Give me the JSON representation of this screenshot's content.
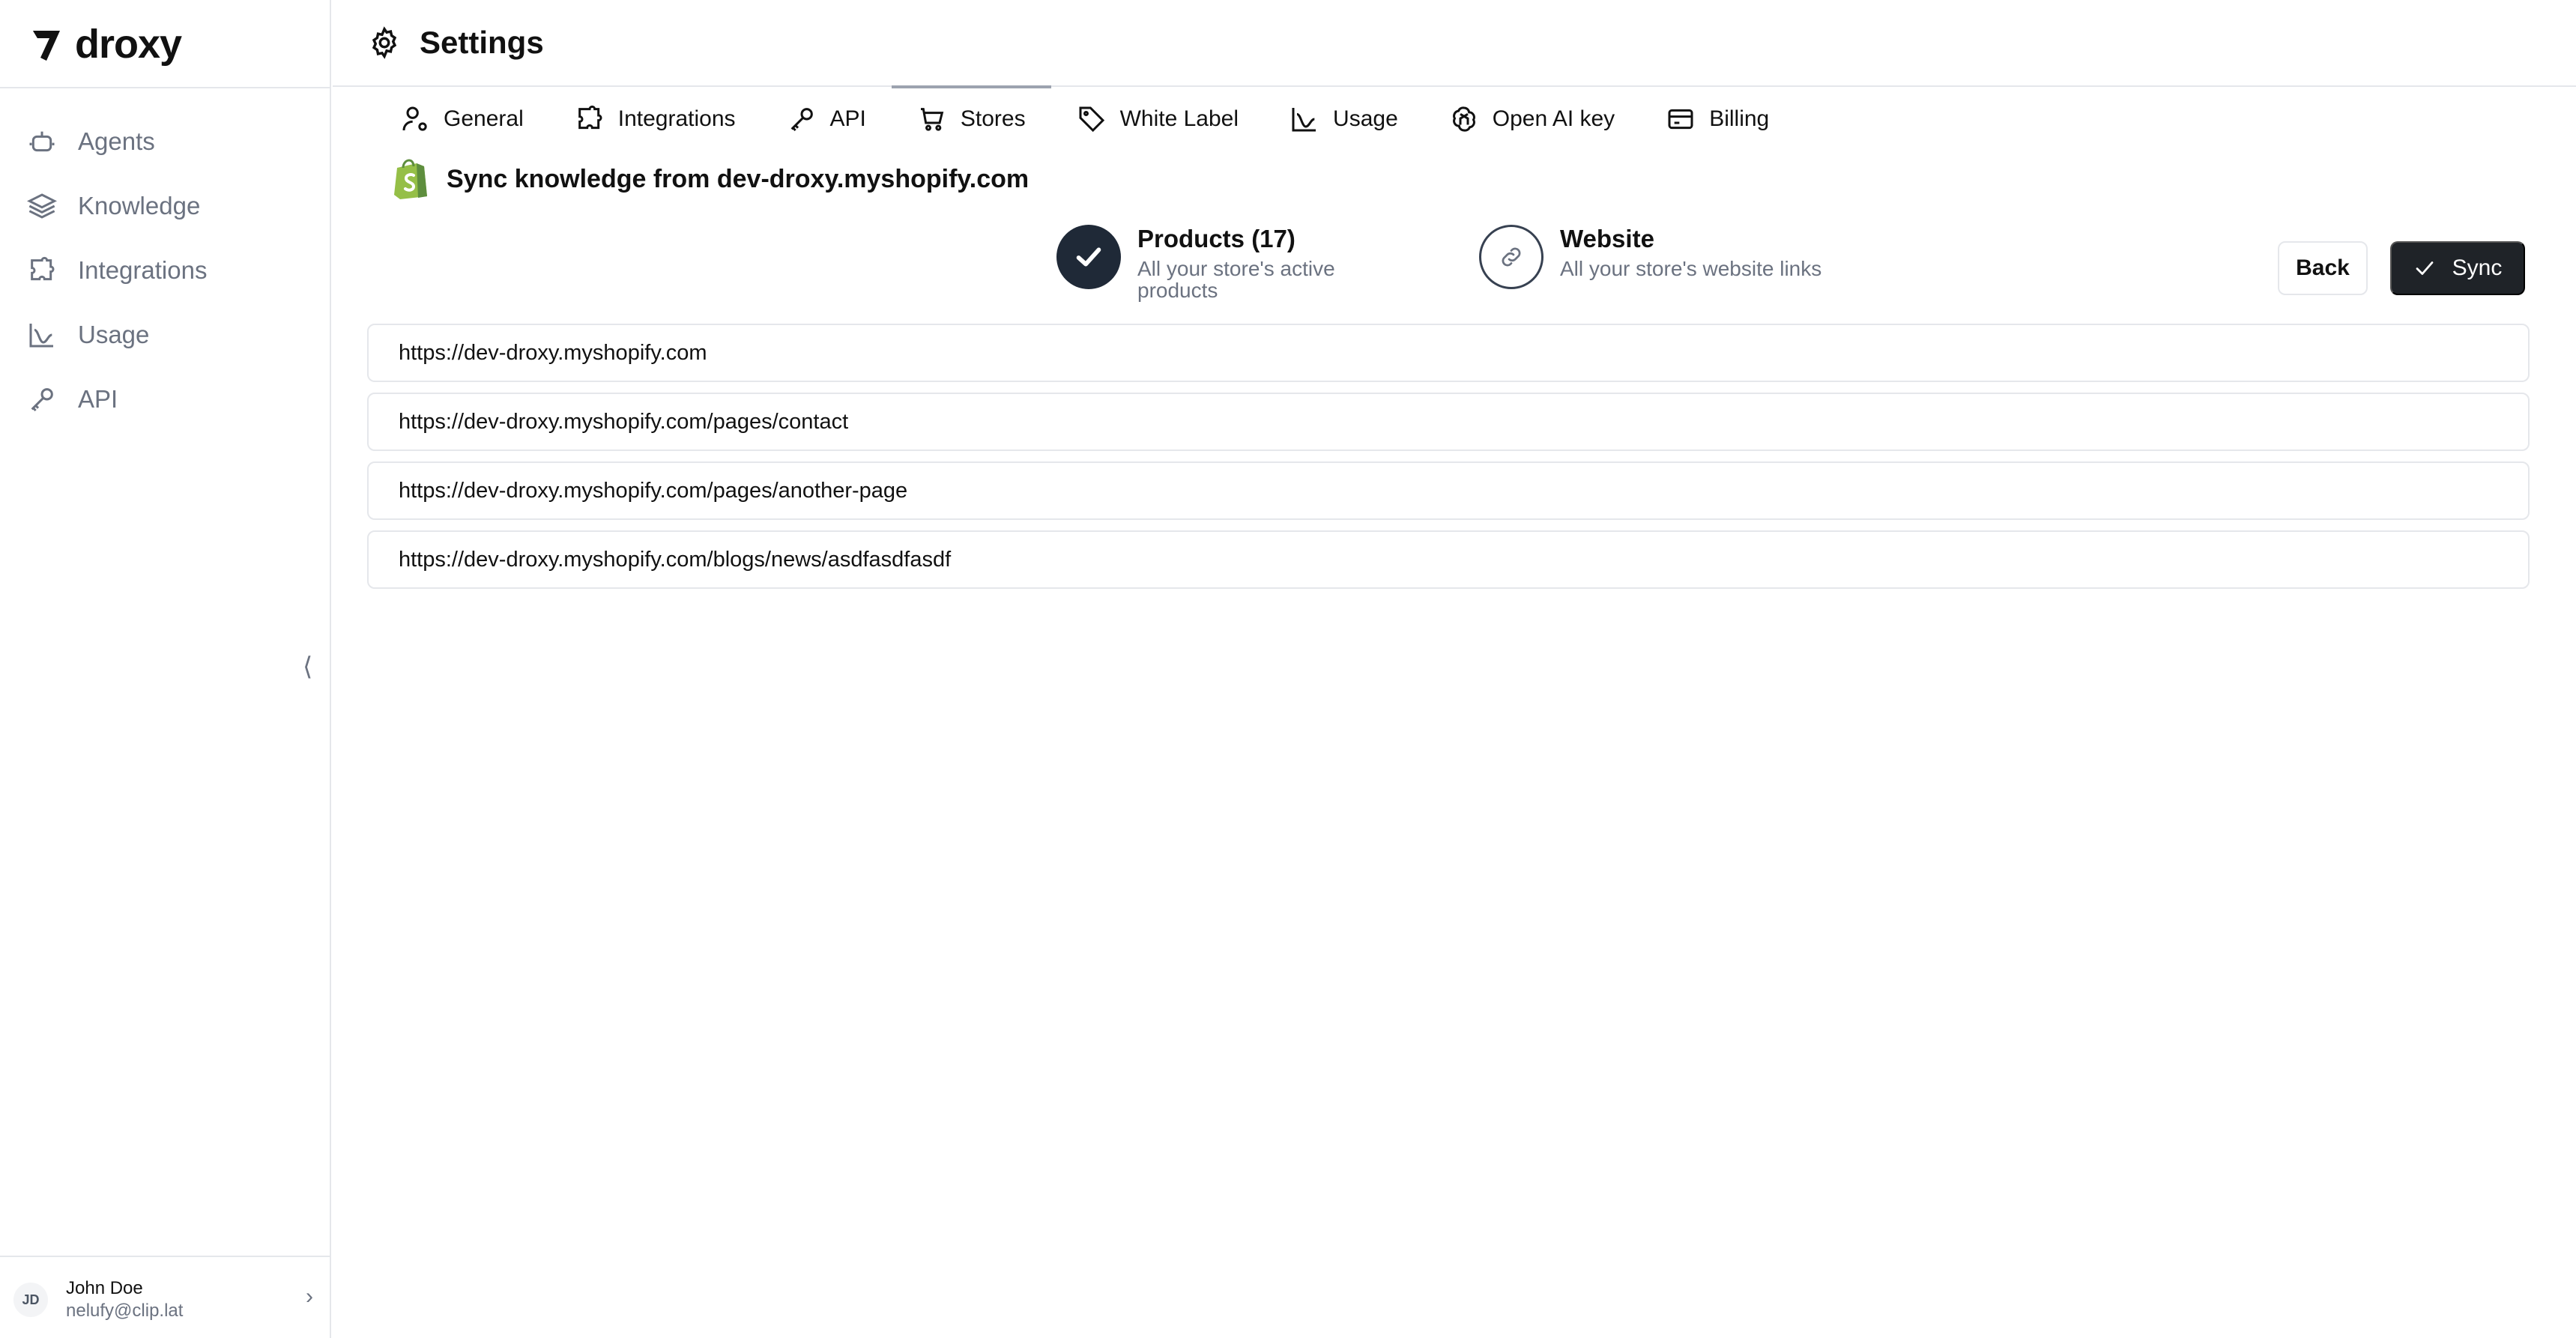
{
  "brand": {
    "name": "droxy"
  },
  "sidebar": {
    "items": [
      {
        "label": "Agents",
        "icon": "bot-icon"
      },
      {
        "label": "Knowledge",
        "icon": "layers-icon"
      },
      {
        "label": "Integrations",
        "icon": "puzzle-icon"
      },
      {
        "label": "Usage",
        "icon": "chart-icon"
      },
      {
        "label": "API",
        "icon": "key-icon"
      }
    ],
    "collapse_glyph": "⟨"
  },
  "user": {
    "initials": "JD",
    "name": "John Doe",
    "email": "nelufy@clip.lat"
  },
  "header": {
    "title": "Settings"
  },
  "tabs": [
    {
      "label": "General",
      "icon": "user-gear-icon"
    },
    {
      "label": "Integrations",
      "icon": "puzzle-icon"
    },
    {
      "label": "API",
      "icon": "key-icon"
    },
    {
      "label": "Stores",
      "icon": "cart-icon",
      "active": true
    },
    {
      "label": "White Label",
      "icon": "tag-icon"
    },
    {
      "label": "Usage",
      "icon": "chart-icon"
    },
    {
      "label": "Open AI key",
      "icon": "openai-icon"
    },
    {
      "label": "Billing",
      "icon": "card-icon"
    }
  ],
  "sync": {
    "title": "Sync knowledge from dev-droxy.myshopify.com"
  },
  "steps": [
    {
      "title": "Products (17)",
      "desc": "All your store's active products",
      "status": "done"
    },
    {
      "title": "Website",
      "desc": "All your store's website links",
      "status": "current"
    }
  ],
  "buttons": {
    "back": "Back",
    "sync": "Sync"
  },
  "urls": [
    "https://dev-droxy.myshopify.com",
    "https://dev-droxy.myshopify.com/pages/contact",
    "https://dev-droxy.myshopify.com/pages/another-page",
    "https://dev-droxy.myshopify.com/blogs/news/asdfasdfasdf"
  ],
  "colors": {
    "primary": "#1f2328",
    "muted": "#6b7280",
    "border": "#e5e7eb",
    "shopify": "#95bf47"
  }
}
